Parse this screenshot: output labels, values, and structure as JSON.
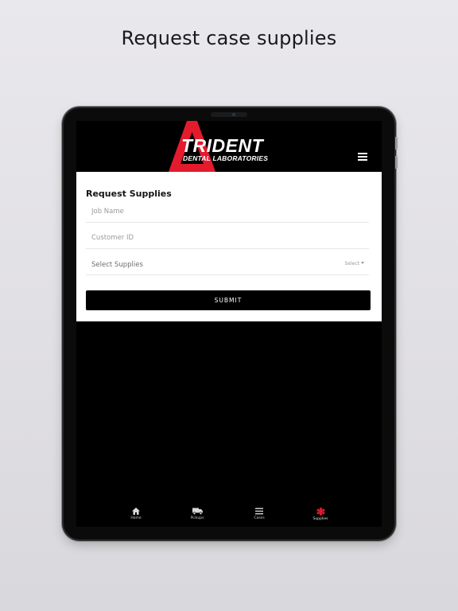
{
  "headline": "Request case supplies",
  "header": {
    "logo_main": "TRIDENT",
    "logo_sub": "DENTAL LABORATORIES",
    "menu_icon": "hamburger-icon",
    "brand_color": "#e31b2d"
  },
  "form": {
    "title": "Request Supplies",
    "job_name_placeholder": "Job Name",
    "customer_id_placeholder": "Customer ID",
    "select_supplies_label": "Select Supplies",
    "select_value": "Select",
    "submit_label": "SUBMIT"
  },
  "nav": {
    "items": [
      {
        "label": "Home",
        "icon": "home-icon"
      },
      {
        "label": "Pickups",
        "icon": "truck-icon"
      },
      {
        "label": "Cases",
        "icon": "list-icon"
      },
      {
        "label": "Supplies",
        "icon": "tooth-icon",
        "active": true
      }
    ],
    "active_color": "#e31b2d"
  }
}
